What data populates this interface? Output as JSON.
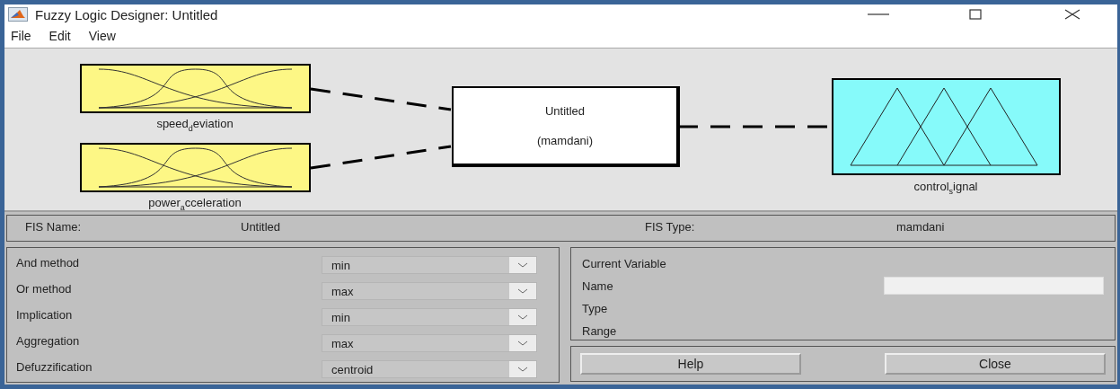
{
  "window": {
    "title": "Fuzzy Logic Designer: Untitled"
  },
  "menu": [
    "File",
    "Edit",
    "View"
  ],
  "diagram": {
    "inputs": [
      {
        "name": "speed$_{d}$eviation"
      },
      {
        "name": "power$_{a}$cceleration"
      }
    ],
    "system": {
      "name": "Untitled",
      "type": "(mamdani)"
    },
    "outputs": [
      {
        "name": "control$_{s}$ignal"
      }
    ]
  },
  "fis": {
    "name_label": "FIS Name:",
    "name": "Untitled",
    "type_label": "FIS Type:",
    "type": "mamdani"
  },
  "methods": [
    {
      "label": "And method",
      "value": "min"
    },
    {
      "label": "Or method",
      "value": "max"
    },
    {
      "label": "Implication",
      "value": "min"
    },
    {
      "label": "Aggregation",
      "value": "max"
    },
    {
      "label": "Defuzzification",
      "value": "centroid"
    }
  ],
  "current_variable": {
    "title": "Current Variable",
    "fields": [
      "Name",
      "Type",
      "Range"
    ]
  },
  "buttons": [
    "Help",
    "Close"
  ]
}
